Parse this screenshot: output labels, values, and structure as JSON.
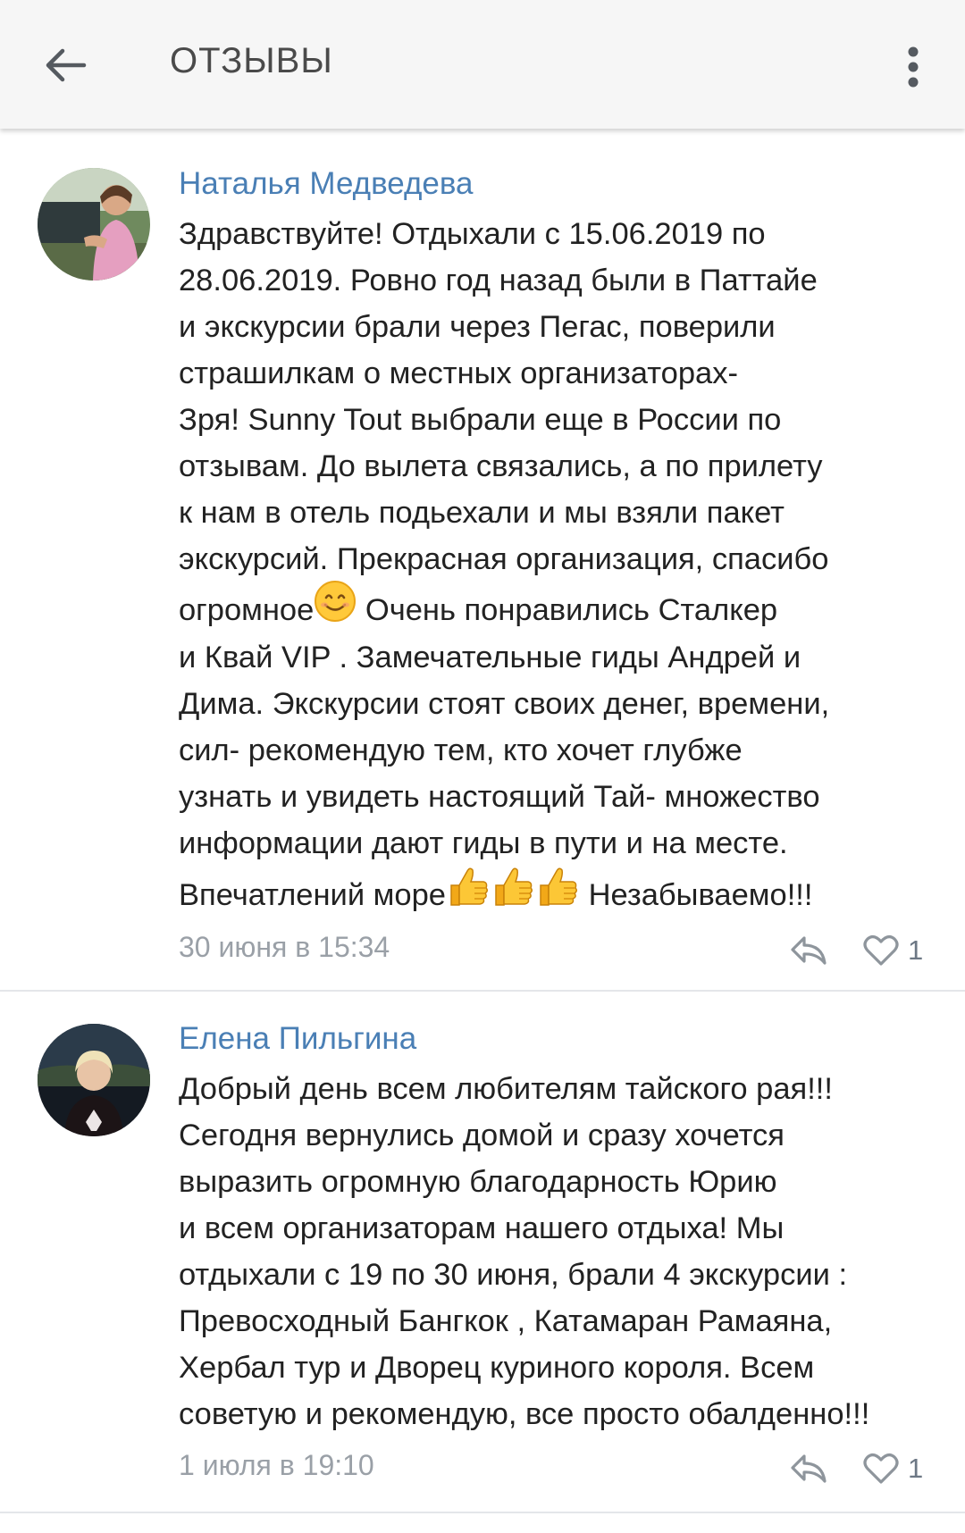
{
  "header": {
    "title": "ОТЗЫВЫ",
    "back_icon": "arrow-left-icon",
    "menu_icon": "more-vertical-icon"
  },
  "colors": {
    "author_link": "#4a7fb5",
    "timestamp": "#9aa0a7",
    "icon_gray": "#8e959c",
    "divider": "#e4e6ea"
  },
  "reviews": [
    {
      "author": "Наталья Медведева",
      "lines": [
        "Здравствуйте! Отдыхали с 15.06.2019 по",
        "28.06.2019. Ровно год назад были в Паттайе",
        "и экскурсии брали через Пегас, поверили",
        "страшилкам о местных организаторах-",
        "Зря! Sunny Tout выбрали еще в России по",
        "отзывам. До вылета связались, а по прилету",
        "к нам в отель подьехали и мы взяли пакет",
        "экскурсий. Прекрасная организация, спасибо",
        "огромное",
        "Очень понравились Сталкер",
        "и Квай VIP . Замечательные гиды Андрей и",
        "Дима. Экскурсии стоят своих денег, времени,",
        "сил- рекомендую тем, кто хочет глубже",
        "узнать и увидеть настоящий Тай- множество",
        "информации дают гиды в пути и на месте.",
        "Впечатлений море",
        "Незабываемо!!!"
      ],
      "emojis": [
        "smiling-face-emoji",
        "thumbs-up-emoji",
        "thumbs-up-emoji",
        "thumbs-up-emoji"
      ],
      "timestamp": "30 июня в 15:34",
      "likes": "1"
    },
    {
      "author": "Елена Пильгина",
      "lines": [
        "Добрый день всем любителям тайского рая!!!",
        "Сегодня вернулись домой и сразу хочется",
        "выразить огромную благодарность Юрию",
        "и всем организаторам нашего отдыха! Мы",
        "отдыхали с 19 по 30 июня, брали 4 экскурсии :",
        "Превосходный Бангкок , Катамаран Рамаяна,",
        "Хербал тур и Дворец куриного короля. Всем",
        "советую и рекомендую, все просто обалденно!!!"
      ],
      "timestamp": "1 июля в 19:10",
      "likes": "1"
    }
  ]
}
